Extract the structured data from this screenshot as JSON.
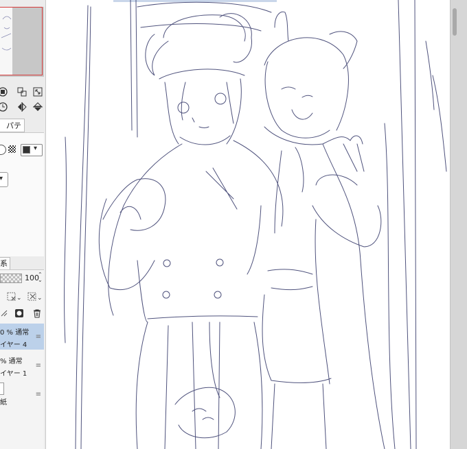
{
  "toolbar": {
    "icons": [
      "stop-icon",
      "fit-icon",
      "expand-icon",
      "rotate-icon",
      "flip-horizontal-icon",
      "flip-vertical-icon"
    ]
  },
  "property_panel": {
    "tab_label": "パティ"
  },
  "layer_panel": {
    "tab_label": "系",
    "opacity_value": "100",
    "opacity_fraction": 1.0,
    "layers": [
      {
        "line1": "0 % 通常",
        "line2": "イヤー 4",
        "selected": true
      },
      {
        "line1": "% 通常",
        "line2": "イヤー 1",
        "selected": false
      },
      {
        "line1": "",
        "line2": "紙",
        "selected": false
      }
    ]
  },
  "colors": {
    "accent_selected": "#bcd1ea",
    "sketch_line": "#3b3f6e",
    "navigator_frame": "#d63a3a"
  }
}
